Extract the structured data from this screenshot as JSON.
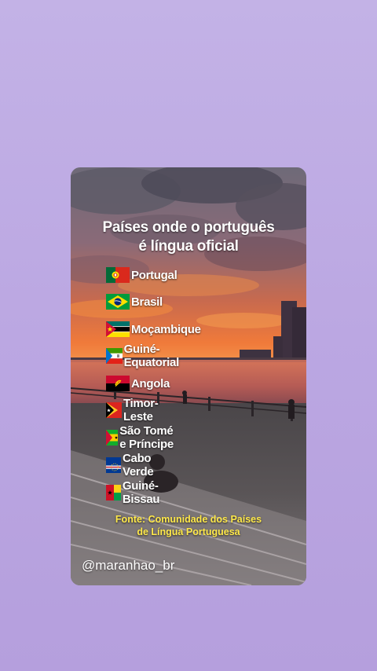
{
  "post": {
    "title_line1": "Países onde o português",
    "title_line2": "é língua oficial",
    "countries": [
      {
        "name": "Portugal",
        "flag_icon": "portugal-flag-icon"
      },
      {
        "name": "Brasil",
        "flag_icon": "brazil-flag-icon"
      },
      {
        "name": "Moçambique",
        "flag_icon": "mozambique-flag-icon"
      },
      {
        "name": "Guiné-Equatorial",
        "flag_icon": "equatorial-guinea-flag-icon"
      },
      {
        "name": "Angola",
        "flag_icon": "angola-flag-icon"
      },
      {
        "name": "Timor-Leste",
        "flag_icon": "timor-leste-flag-icon"
      },
      {
        "name": "São Tomé e Príncipe",
        "flag_icon": "sao-tome-flag-icon"
      },
      {
        "name": "Cabo Verde",
        "flag_icon": "cape-verde-flag-icon"
      },
      {
        "name": "Guiné-Bissau",
        "flag_icon": "guinea-bissau-flag-icon"
      }
    ],
    "source_line1": "Fonte: Comunidade dos Países",
    "source_line2": "de Língua Portuguesa",
    "handle": "@maranhao_br"
  },
  "colors": {
    "background": "#bfaee4",
    "title_text": "#ffffff",
    "source_text": "#ffe94a"
  }
}
